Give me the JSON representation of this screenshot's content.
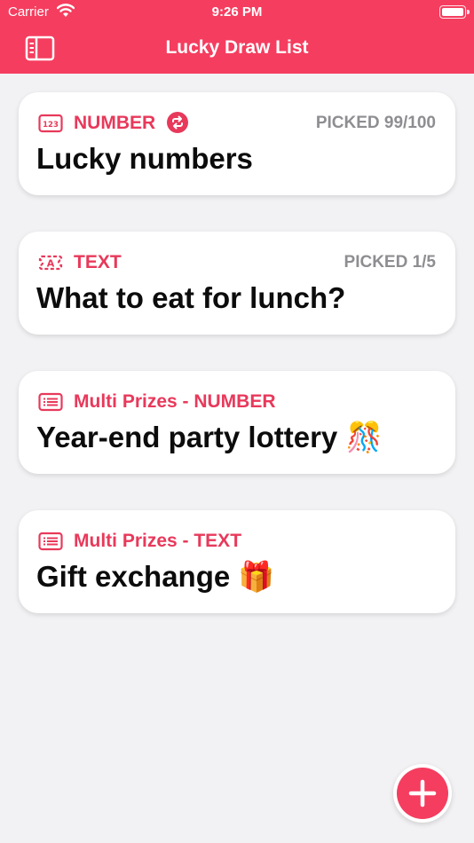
{
  "status_bar": {
    "carrier": "Carrier",
    "time": "9:26 PM"
  },
  "nav": {
    "title": "Lucky Draw List"
  },
  "colors": {
    "accent": "#f53d5f",
    "tag": "#e8395b",
    "picked": "#8e8e92"
  },
  "cards": [
    {
      "icon": "number-123-icon",
      "tag": "NUMBER",
      "picked": "PICKED 99/100",
      "title": "Lucky numbers",
      "repeat_icon": "repeat-icon"
    },
    {
      "icon": "text-a-icon",
      "tag": "TEXT",
      "picked": "PICKED 1/5",
      "title": "What to eat for lunch?"
    },
    {
      "icon": "list-icon",
      "tag": "Multi Prizes - NUMBER",
      "title": "Year-end party lottery 🎊"
    },
    {
      "icon": "list-icon",
      "tag": "Multi Prizes - TEXT",
      "title": "Gift exchange 🎁"
    }
  ],
  "fab": {
    "icon": "plus-icon"
  }
}
